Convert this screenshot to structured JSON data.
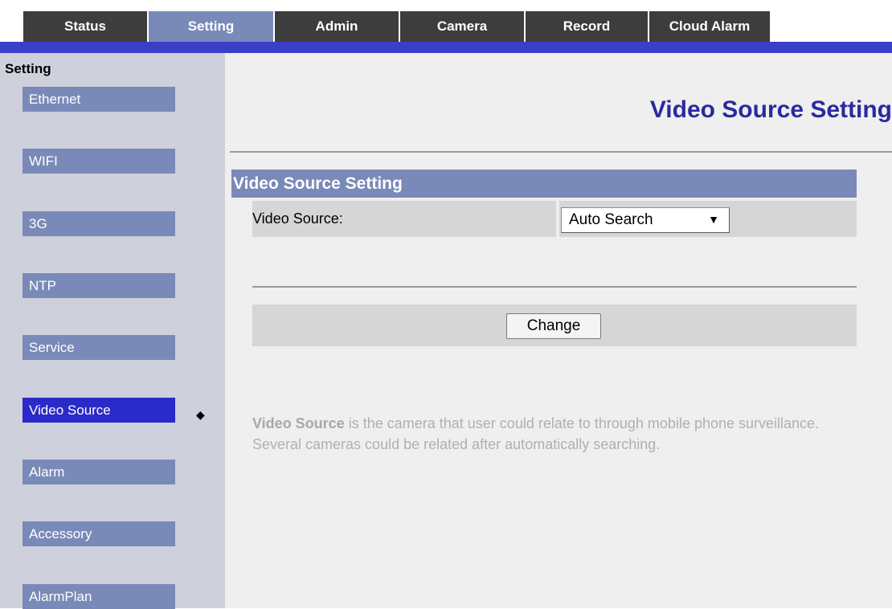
{
  "tabs": [
    {
      "label": "Status",
      "active": false
    },
    {
      "label": "Setting",
      "active": true
    },
    {
      "label": "Admin",
      "active": false
    },
    {
      "label": "Camera",
      "active": false
    },
    {
      "label": "Record",
      "active": false
    },
    {
      "label": "Cloud Alarm",
      "active": false
    }
  ],
  "sidebar": {
    "title": "Setting",
    "items": [
      {
        "label": "Ethernet",
        "active": false
      },
      {
        "label": "WIFI",
        "active": false
      },
      {
        "label": "3G",
        "active": false
      },
      {
        "label": "NTP",
        "active": false
      },
      {
        "label": "Service",
        "active": false
      },
      {
        "label": "Video Source",
        "active": true
      },
      {
        "label": "Alarm",
        "active": false
      },
      {
        "label": "Accessory",
        "active": false
      },
      {
        "label": "AlarmPlan",
        "active": false
      }
    ],
    "active_marker": "◆"
  },
  "main": {
    "page_title": "Video Source Setting",
    "section_header": "Video Source Setting",
    "form": {
      "video_source_label": "Video Source:",
      "video_source_value": "Auto Search",
      "select_arrow": "▼"
    },
    "change_label": "Change",
    "help": {
      "term": "Video Source",
      "text": " is the camera that user could relate to through mobile phone surveillance. Several cameras could be related after automatically searching."
    }
  },
  "colors": {
    "tab_bg": "#3d3d3d",
    "tab_active_bg": "#7a8ab8",
    "blue_bar": "#3b3fc7",
    "sidebar_bg": "#ced0db",
    "sidebar_item_bg": "#7a8ab8",
    "sidebar_item_active_bg": "#2a2ac8",
    "title_color": "#2a2a9e"
  }
}
